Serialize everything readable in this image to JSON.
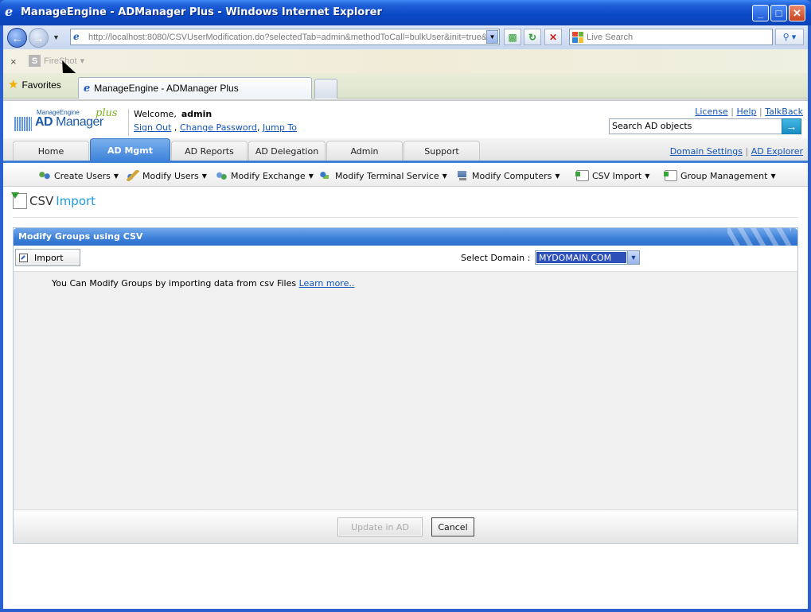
{
  "window": {
    "title": "ManageEngine - ADManager Plus - Windows Internet Explorer",
    "min_glyph": "_",
    "max_glyph": "□",
    "close_glyph": "✕"
  },
  "browser": {
    "address_host": "http://localhost",
    "address_rest": ":8080/CSVUserModification.do?selectedTab=admin&methodToCall=bulkUser&init=true&",
    "live_search_placeholder": "Live Search",
    "links_close": "×",
    "fireshot_label": "FireShot",
    "favorites_label": "Favorites",
    "tab_title": "ManageEngine - ADManager Plus"
  },
  "header": {
    "logo_company": "ManageEngine",
    "logo_ad": "AD",
    "logo_product": "Manager",
    "logo_plus": "plus",
    "welcome_label": "Welcome,",
    "username": "admin",
    "sign_out": "Sign Out",
    "change_password": "Change Password",
    "jump_to": "Jump To",
    "license": "License",
    "help": "Help",
    "talkback": "TalkBack",
    "search_value": "Search AD objects",
    "domain_settings": "Domain Settings",
    "ad_explorer": "AD Explorer"
  },
  "tabs": [
    {
      "label": "Home"
    },
    {
      "label": "AD Mgmt"
    },
    {
      "label": "AD Reports"
    },
    {
      "label": "AD Delegation"
    },
    {
      "label": "Admin"
    },
    {
      "label": "Support"
    }
  ],
  "menu": [
    {
      "label": "Create Users",
      "icon": "create-users-icon"
    },
    {
      "label": "Modify Users",
      "icon": "modify-users-icon"
    },
    {
      "label": "Modify Exchange",
      "icon": "modify-exchange-icon"
    },
    {
      "label": "Modify Terminal Service",
      "icon": "terminal-service-icon"
    },
    {
      "label": "Modify Computers",
      "icon": "computer-icon"
    },
    {
      "label": "CSV Import",
      "icon": "csv-import-icon"
    },
    {
      "label": "Group Management",
      "icon": "group-management-icon"
    }
  ],
  "page": {
    "heading_1": "CSV",
    "heading_2": "Import",
    "panel_title": "Modify Groups using CSV",
    "import_label": "Import",
    "select_domain_label": "Select Domain :",
    "domain_value": "MYDOMAIN.COM",
    "info_text": "You Can Modify Groups by importing data from csv Files",
    "learn_more": "Learn more..",
    "update_button": "Update in AD",
    "cancel_button": "Cancel"
  },
  "colors": {
    "accent_blue": "#3f7fd6",
    "link_blue": "#1454b8",
    "heading_cyan": "#1b9ce0",
    "titlebar_blue": "#0b48c4"
  }
}
